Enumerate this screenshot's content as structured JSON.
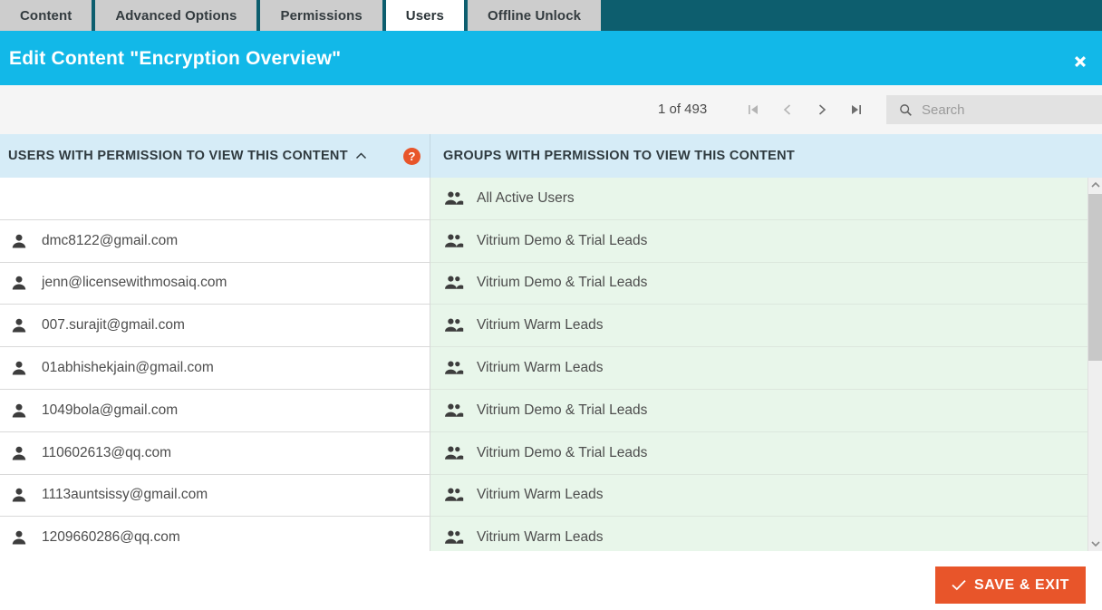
{
  "tabs": [
    {
      "label": "Content",
      "active": false
    },
    {
      "label": "Advanced Options",
      "active": false
    },
    {
      "label": "Permissions",
      "active": false
    },
    {
      "label": "Users",
      "active": true
    },
    {
      "label": "Offline Unlock",
      "active": false
    }
  ],
  "titlebar": {
    "title": "Edit Content \"Encryption Overview\"",
    "close_icon": "close-icon"
  },
  "toolbar": {
    "page_count": "1 of 493",
    "first_icon": "first-page-icon",
    "prev_icon": "previous-page-icon",
    "next_icon": "next-page-icon",
    "last_icon": "last-page-icon",
    "search_icon": "search-icon",
    "search_placeholder": "Search",
    "search_value": ""
  },
  "columns": {
    "users_header": "USERS WITH PERMISSION TO VIEW THIS CONTENT",
    "users_sort_icon": "sort-ascending-caret-icon",
    "help_icon_label": "?",
    "groups_header": "GROUPS WITH PERMISSION TO VIEW THIS CONTENT"
  },
  "users": [
    {
      "label": "",
      "icon": ""
    },
    {
      "label": "dmc8122@gmail.com",
      "icon": "user-icon"
    },
    {
      "label": "jenn@licensewithmosaiq.com",
      "icon": "user-icon"
    },
    {
      "label": "007.surajit@gmail.com",
      "icon": "user-icon"
    },
    {
      "label": "01abhishekjain@gmail.com",
      "icon": "user-icon"
    },
    {
      "label": "1049bola@gmail.com",
      "icon": "user-icon"
    },
    {
      "label": "110602613@qq.com",
      "icon": "user-icon"
    },
    {
      "label": "1113auntsissy@gmail.com",
      "icon": "user-icon"
    },
    {
      "label": "1209660286@qq.com",
      "icon": "user-icon"
    }
  ],
  "groups": [
    {
      "label": "All Active Users",
      "icon": "group-icon"
    },
    {
      "label": "Vitrium Demo & Trial Leads",
      "icon": "group-icon"
    },
    {
      "label": "Vitrium Demo & Trial Leads",
      "icon": "group-icon"
    },
    {
      "label": "Vitrium Warm Leads",
      "icon": "group-icon"
    },
    {
      "label": "Vitrium Warm Leads",
      "icon": "group-icon"
    },
    {
      "label": "Vitrium Demo & Trial Leads",
      "icon": "group-icon"
    },
    {
      "label": "Vitrium Demo & Trial Leads",
      "icon": "group-icon"
    },
    {
      "label": "Vitrium Warm Leads",
      "icon": "group-icon"
    },
    {
      "label": "Vitrium Warm Leads",
      "icon": "group-icon"
    }
  ],
  "scrollbar": {
    "up_icon": "scroll-up-icon",
    "down_icon": "scroll-down-icon"
  },
  "footer": {
    "save_label": "SAVE & EXIT",
    "save_icon": "checkmark-icon"
  },
  "colors": {
    "tabbar": "#0d5e6e",
    "accent_cyan": "#12b8e8",
    "header_blue": "#d6ecf7",
    "groups_green": "#e8f6ea",
    "orange": "#e8552a"
  }
}
